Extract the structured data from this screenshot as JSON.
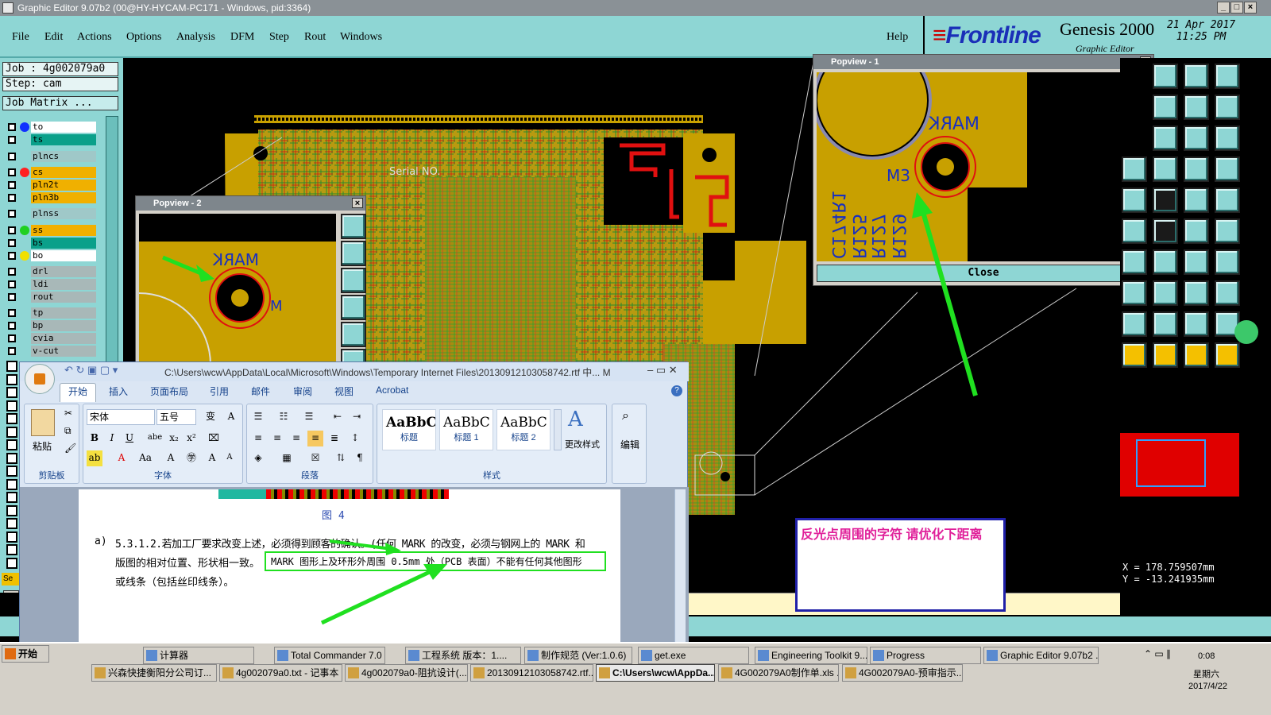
{
  "window": {
    "title": "Graphic Editor 9.07b2 (00@HY-HYCAM-PC171 - Windows, pid:3364)"
  },
  "menu": {
    "items": [
      "File",
      "Edit",
      "Actions",
      "Options",
      "Analysis",
      "DFM",
      "Step",
      "Rout",
      "Windows"
    ],
    "help": "Help"
  },
  "brand": {
    "logo": "Frontline",
    "product": "Genesis 2000",
    "subtitle": "Graphic Editor",
    "date": "21 Apr 2017",
    "time": "11:25 PM"
  },
  "job": {
    "job_label": "Job : 4g002079a0",
    "step_label": "Step: cam",
    "matrix_button": "Job Matrix ..."
  },
  "layers": [
    {
      "name": "to",
      "bg": "#ffffff",
      "dot": "#1030ff"
    },
    {
      "name": "ts",
      "bg": "#0aa08a",
      "dot": ""
    },
    {
      "name": "plncs",
      "bg": "#9fc8c8",
      "dot": ""
    },
    {
      "name": "cs",
      "bg": "#f0b000",
      "dot": "#ff2020"
    },
    {
      "name": "pln2t",
      "bg": "#f0b000",
      "dot": ""
    },
    {
      "name": "pln3b",
      "bg": "#f0b000",
      "dot": ""
    },
    {
      "name": "plnss",
      "bg": "#9fc8c8",
      "dot": ""
    },
    {
      "name": "ss",
      "bg": "#f0b000",
      "dot": "#20d020"
    },
    {
      "name": "bs",
      "bg": "#0aa08a",
      "dot": ""
    },
    {
      "name": "bo",
      "bg": "#ffffff",
      "dot": "#f0e000"
    },
    {
      "name": "drl",
      "bg": "#a8b8b8",
      "dot": ""
    },
    {
      "name": "ldi",
      "bg": "#a8b8b8",
      "dot": ""
    },
    {
      "name": "rout",
      "bg": "#a8b8b8",
      "dot": ""
    },
    {
      "name": "tp",
      "bg": "#a8b8b8",
      "dot": ""
    },
    {
      "name": "bp",
      "bg": "#a8b8b8",
      "dot": ""
    },
    {
      "name": "cvia",
      "bg": "#a8b8b8",
      "dot": ""
    },
    {
      "name": "v-cut",
      "bg": "#a8b8b8",
      "dot": ""
    }
  ],
  "board": {
    "serial_label": "Serial NO."
  },
  "popview1": {
    "title": "Popview - 1",
    "mark_text": "MARK",
    "m_text": "M3",
    "refs": [
      "R129",
      "R127",
      "R125",
      "C174R1"
    ],
    "close_button": "Close"
  },
  "popview2": {
    "title": "Popview - 2",
    "mark_text": "MARK",
    "m_text": "M"
  },
  "coords": {
    "x": "X = 178.759507mm",
    "y": "Y = -13.241935mm",
    "units": "MM"
  },
  "note": {
    "text": "反光点周围的字符  请优化下距离"
  },
  "word": {
    "path": "C:\\Users\\wcw\\AppData\\Local\\Microsoft\\Windows\\Temporary Internet Files\\20130912103058742.rtf 中... M",
    "tabs": [
      "开始",
      "插入",
      "页面布局",
      "引用",
      "邮件",
      "审阅",
      "视图",
      "Acrobat"
    ],
    "groups": [
      "剪贴板",
      "字体",
      "段落",
      "样式"
    ],
    "paste": "粘贴",
    "font_name": "宋体",
    "font_size": "五号",
    "styles": [
      {
        "sample": "AaBbC",
        "label": "标题"
      },
      {
        "sample": "AaBbC",
        "label": "标题 1"
      },
      {
        "sample": "AaBbC",
        "label": "标题 2"
      }
    ],
    "change_styles": "更改样式",
    "edit": "编辑",
    "figure_caption": "图 4",
    "para_prefix": "a)",
    "line1": "5.3.1.2.若加工厂要求改变上述，必须得到顾客的确认。(任何 MARK 的改变，必须与钢网上的 MARK 和",
    "line2": "版图的相对位置、形状相一致。",
    "line2b": "MARK 图形上及环形外周围 0.5mm 处（PCB 表面）不能有任何其他图形",
    "line3": "或线条（包括丝印线条）。"
  },
  "taskbar": {
    "start": "开始",
    "row1": [
      "计算器",
      "Total Commander 7.0 ...",
      "工程系统  版本：1....",
      "制作规范 (Ver:1.0.6)",
      "get.exe",
      "Engineering Toolkit 9....",
      "Progress",
      "Graphic Editor 9.07b2 ..."
    ],
    "row2": [
      "兴森快捷衡阳分公司订...",
      "4g002079a0.txt - 记事本",
      "4g002079a0-阻抗设计(...",
      "20130912103058742.rtf...",
      "C:\\Users\\wcw\\AppDa...",
      "4G002079A0制作单.xls ...",
      "4G002079A0-预审指示..."
    ],
    "clock_time": "0:08",
    "clock_day": "星期六",
    "clock_date": "2017/4/22"
  },
  "colors": {
    "teal": "#8ed6d4",
    "board": "#c8a000",
    "pcb_gold": "#b89a10",
    "mark_red": "#e01010",
    "arrow": "#20e020"
  }
}
